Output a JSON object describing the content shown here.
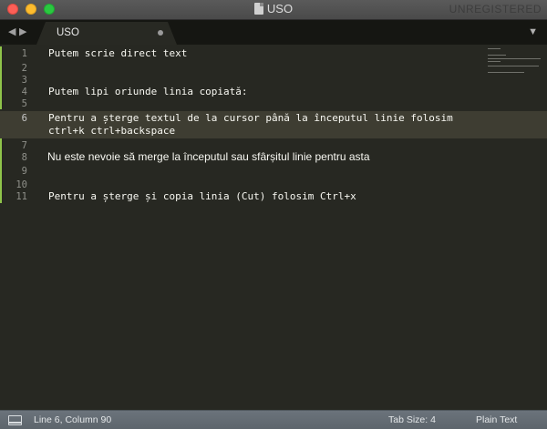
{
  "window": {
    "title": "USO",
    "registration": "UNREGISTERED"
  },
  "tabs": [
    {
      "label": "USO",
      "dirty": true
    }
  ],
  "editor": {
    "lines": [
      {
        "number": "1",
        "text": "Putem scrie direct text"
      },
      {
        "number": "2",
        "text": ""
      },
      {
        "number": "3",
        "text": ""
      },
      {
        "number": "4",
        "text": "Putem lipi oriunde linia copiată:"
      },
      {
        "number": "5",
        "text": ""
      },
      {
        "number": "6",
        "text": "Pentru a șterge textul de la cursor până la începutul linie folosim",
        "wrap": "ctrl+k ctrl+backspace"
      },
      {
        "number": "7",
        "text": ""
      },
      {
        "number": "8",
        "text": "Nu este nevoie să merge la începutul sau sfârșitul linie pentru asta"
      },
      {
        "number": "9",
        "text": ""
      },
      {
        "number": "10",
        "text": ""
      },
      {
        "number": "11",
        "text": "Pentru a șterge și copia linia (Cut) folosim Ctrl+x"
      }
    ],
    "current_line": "6"
  },
  "statusbar": {
    "position": "Line 6, Column 90",
    "tab_size": "Tab Size: 4",
    "syntax": "Plain Text"
  },
  "colors": {
    "background": "#272822",
    "current_line": "#3e3d32",
    "modified_marker": "#8fc44a",
    "statusbar": "#646c73"
  },
  "icons": {
    "back": "triangle-left",
    "forward": "triangle-right",
    "tab_menu": "triangle-down",
    "panel": "panel-toggle"
  }
}
